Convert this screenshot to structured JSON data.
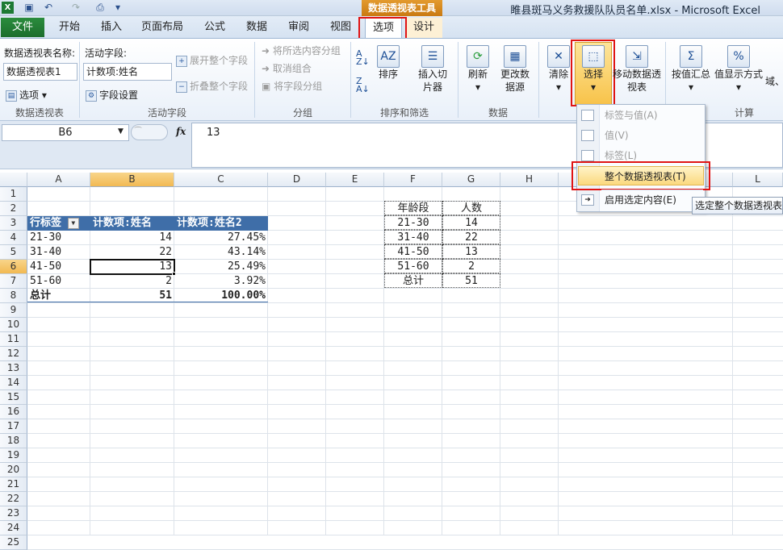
{
  "window": {
    "app_title": "睢县斑马义务救援队队员名单.xlsx  -  Microsoft Excel",
    "context_tab_title": "数据透视表工具"
  },
  "tabs": {
    "file": "文件",
    "items": [
      "开始",
      "插入",
      "页面布局",
      "公式",
      "数据",
      "审阅",
      "视图"
    ],
    "options": "选项",
    "design": "设计"
  },
  "ribbon": {
    "pivot_name_label": "数据透视表名称:",
    "pivot_name_value": "数据透视表1",
    "options_btn": "选项",
    "group_pivot": "数据透视表",
    "active_field_label": "活动字段:",
    "active_field_value": "计数项:姓名",
    "field_settings": "字段设置",
    "expand_field": "展开整个字段",
    "collapse_field": "折叠整个字段",
    "group_active_field": "活动字段",
    "group_selection": "将所选内容分组",
    "ungroup": "取消组合",
    "group_field": "将字段分组",
    "group_group": "分组",
    "sort": "排序",
    "insert_slicer": "插入切片器",
    "group_sort_filter": "排序和筛选",
    "refresh": "刷新",
    "change_source": "更改数据源",
    "group_data": "数据",
    "clear": "清除",
    "select": "选择",
    "move_pivot": "移动数据透视表",
    "summarize_by": "按值汇总",
    "show_values_as": "值显示方式",
    "fields_items": "域、",
    "group_calc": "计算"
  },
  "formula_bar": {
    "name_box": "B6",
    "fx": "fx",
    "value": "13"
  },
  "sheet": {
    "columns": [
      "A",
      "B",
      "C",
      "D",
      "E",
      "F",
      "G",
      "H",
      "I",
      "L"
    ],
    "rows": [
      "1",
      "2",
      "3",
      "4",
      "5",
      "6",
      "7",
      "8",
      "9",
      "10",
      "11",
      "12",
      "13",
      "14",
      "15",
      "16",
      "17",
      "18",
      "19",
      "20",
      "21",
      "22",
      "23",
      "24",
      "25"
    ],
    "pivot": {
      "headers": [
        "行标签",
        "计数项:姓名",
        "计数项:姓名2"
      ],
      "rows": [
        [
          "21-30",
          "14",
          "27.45%"
        ],
        [
          "31-40",
          "22",
          "43.14%"
        ],
        [
          "41-50",
          "13",
          "25.49%"
        ],
        [
          "51-60",
          "2",
          "3.92%"
        ]
      ],
      "total": [
        "总计",
        "51",
        "100.00%"
      ]
    },
    "table": {
      "headers": [
        "年龄段",
        "人数"
      ],
      "rows": [
        [
          "21-30",
          "14"
        ],
        [
          "31-40",
          "22"
        ],
        [
          "41-50",
          "13"
        ],
        [
          "51-60",
          "2"
        ]
      ],
      "total": [
        "总计",
        "51"
      ]
    }
  },
  "select_menu": {
    "labels_values": "标签与值(A)",
    "values": "值(V)",
    "labels": "标签(L)",
    "entire_pivot": "整个数据透视表(T)",
    "enable_selection": "启用选定内容(E)"
  },
  "tooltip": "选定整个数据透视表"
}
